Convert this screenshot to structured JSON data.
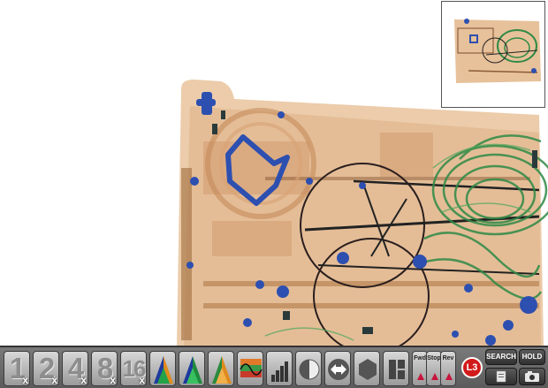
{
  "toolbar": {
    "zoom_buttons": [
      {
        "label": "1",
        "close": "x"
      },
      {
        "label": "2",
        "close": "x"
      },
      {
        "label": "4",
        "close": "x"
      },
      {
        "label": "8",
        "close": "x"
      },
      {
        "label": "16",
        "close": "x"
      }
    ],
    "fwd_label": "Fwd",
    "stop_label": "Stop",
    "rev_label": "Rev",
    "logo_text": "L3",
    "search_label": "SEARCH",
    "hold_label": "HOLD"
  },
  "colors": {
    "toolbar_bg": "#6a6a6a",
    "scan_orange": "#e2b07e",
    "scan_green": "#2f8a46",
    "scan_blue": "#2d4fb0",
    "logo_red": "#d11a1a"
  }
}
